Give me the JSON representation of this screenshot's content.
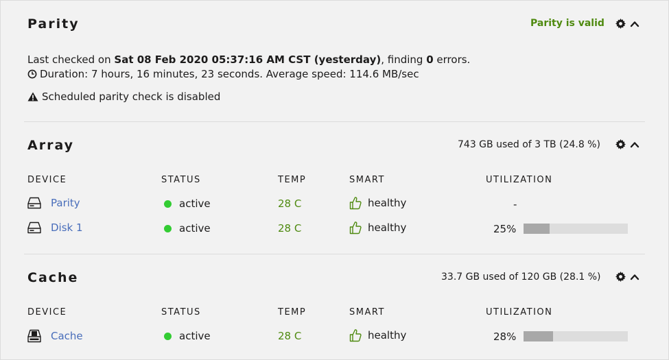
{
  "parity": {
    "title": "Parity",
    "status": "Parity is valid",
    "last_checked_prefix": "Last checked on",
    "last_checked_date": "Sat 08 Feb 2020 05:37:16 AM CST (yesterday)",
    "finding_prefix": ", finding",
    "error_count": "0",
    "errors_suffix": "errors.",
    "duration": "Duration: 7 hours, 16 minutes, 23 seconds. Average speed: 114.6 MB/sec",
    "schedule_warning": "Scheduled parity check is disabled"
  },
  "columns": {
    "device": "DEVICE",
    "status": "STATUS",
    "temp": "TEMP",
    "smart": "SMART",
    "utilization": "UTILIZATION"
  },
  "array": {
    "title": "Array",
    "usage": "743 GB used of 3 TB (24.8 %)",
    "devices": [
      {
        "name": "Parity",
        "status": "active",
        "temp": "28 C",
        "smart": "healthy",
        "utilization_text": "-",
        "utilization": null
      },
      {
        "name": "Disk 1",
        "status": "active",
        "temp": "28 C",
        "smart": "healthy",
        "utilization_text": "25%",
        "utilization": 25
      }
    ]
  },
  "cache": {
    "title": "Cache",
    "usage": "33.7 GB used of 120 GB (28.1 %)",
    "devices": [
      {
        "name": "Cache",
        "status": "active",
        "temp": "28 C",
        "smart": "healthy",
        "utilization_text": "28%",
        "utilization": 28
      }
    ]
  },
  "colors": {
    "link": "#486dba",
    "ok_green": "#4f8a10",
    "active_dot": "#33cc33",
    "bar_track": "#dddddd",
    "bar_fill": "#a8a8a8"
  },
  "icons": [
    "gear-icon",
    "chevron-up-icon",
    "clock-icon",
    "warning-icon",
    "disk-icon",
    "ssd-icon",
    "thumbs-up-icon"
  ]
}
